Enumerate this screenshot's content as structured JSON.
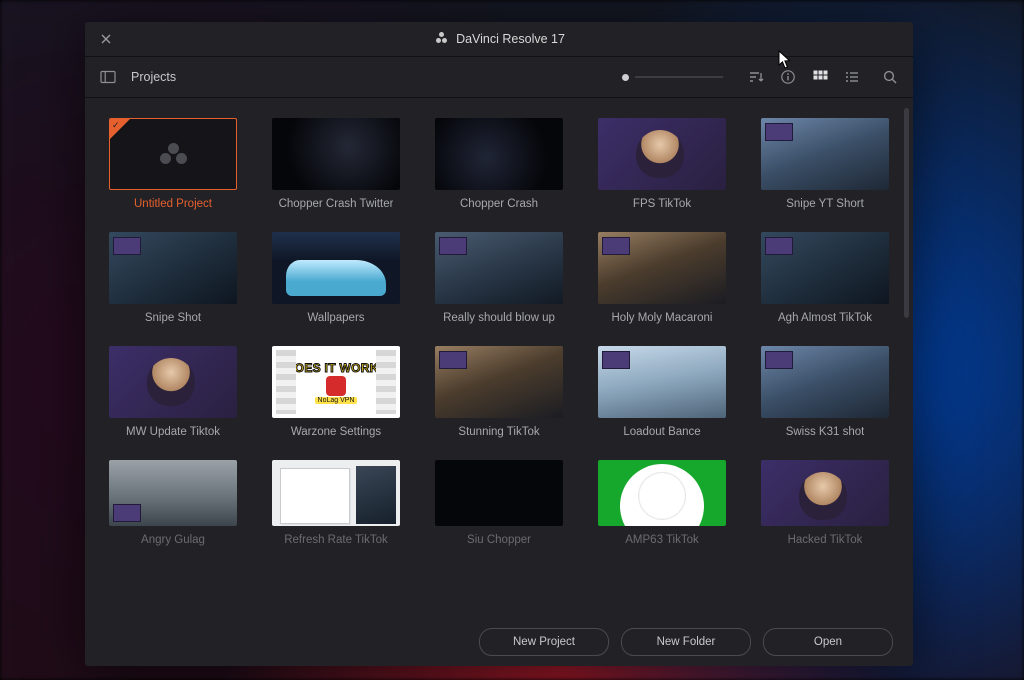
{
  "window": {
    "title": "DaVinci Resolve 17"
  },
  "toolbar": {
    "breadcrumb": "Projects"
  },
  "projects": [
    {
      "label": "Untitled Project",
      "thumb": "logo",
      "selected": true
    },
    {
      "label": "Chopper Crash Twitter",
      "thumb": "dark"
    },
    {
      "label": "Chopper Crash",
      "thumb": "dark2"
    },
    {
      "label": "FPS TikTok",
      "thumb": "streamer"
    },
    {
      "label": "Snipe YT Short",
      "thumb": "game"
    },
    {
      "label": "Snipe Shot",
      "thumb": "game2"
    },
    {
      "label": "Wallpapers",
      "thumb": "car"
    },
    {
      "label": "Really should blow up",
      "thumb": "game3"
    },
    {
      "label": "Holy Moly Macaroni",
      "thumb": "interior"
    },
    {
      "label": "Agh Almost TikTok",
      "thumb": "game2"
    },
    {
      "label": "MW Update Tiktok",
      "thumb": "streamer"
    },
    {
      "label": "Warzone Settings",
      "thumb": "warzone"
    },
    {
      "label": "Stunning TikTok",
      "thumb": "interior"
    },
    {
      "label": "Loadout Bance",
      "thumb": "bright"
    },
    {
      "label": "Swiss K31 shot",
      "thumb": "game"
    },
    {
      "label": "Angry Gulag",
      "thumb": "foggy"
    },
    {
      "label": "Refresh Rate TikTok",
      "thumb": "desktop"
    },
    {
      "label": "Siu Chopper",
      "thumb": "black"
    },
    {
      "label": "AMP63 TikTok",
      "thumb": "green"
    },
    {
      "label": "Hacked TikTok",
      "thumb": "streamer"
    }
  ],
  "warzone_text": {
    "top": "DOES IT WORK?",
    "vpn": "NoLag VPN"
  },
  "footer": {
    "new_project": "New Project",
    "new_folder": "New Folder",
    "open": "Open"
  }
}
